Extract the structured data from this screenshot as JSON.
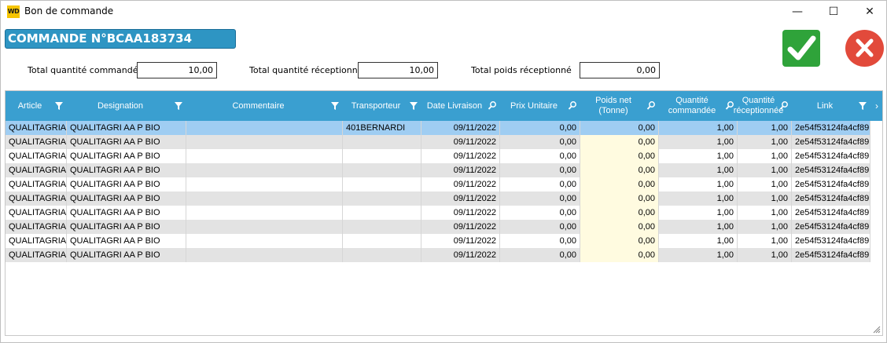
{
  "window": {
    "title": "Bon de commande",
    "app_icon_text": "WD",
    "minimize_glyph": "—",
    "maximize_glyph": "☐",
    "close_glyph": "✕"
  },
  "header": {
    "order_title": "COMMANDE N°BCAA183734",
    "validate_icon": "check-icon",
    "cancel_icon": "close-icon",
    "validate_color": "#2fa33a",
    "cancel_color": "#e24a3b"
  },
  "totals": [
    {
      "label": "Total quantité commandé",
      "value": "10,00"
    },
    {
      "label": "Total quantité réceptionné",
      "value": "10,00"
    },
    {
      "label": "Total poids réceptionné",
      "value": "0,00"
    }
  ],
  "grid": {
    "header_color": "#3a9fd0",
    "columns": [
      {
        "label": "Article",
        "icon": "filter-icon"
      },
      {
        "label": "Designation",
        "icon": "filter-icon"
      },
      {
        "label": "Commentaire",
        "icon": "filter-icon"
      },
      {
        "label": "Transporteur",
        "icon": "filter-icon"
      },
      {
        "label": "Date Livraison",
        "icon": "search-icon"
      },
      {
        "label": "Prix Unitaire",
        "icon": "search-icon"
      },
      {
        "label": "Poids net (Tonne)",
        "icon": "search-icon"
      },
      {
        "label": "Quantité commandée",
        "icon": "search-icon"
      },
      {
        "label": "Quantité réceptionnée",
        "icon": "search-icon"
      },
      {
        "label": "Link",
        "icon": "filter-icon"
      }
    ],
    "rows": [
      [
        "QUALITAGRIA",
        "QUALITAGRI AA P BIO",
        "",
        "401BERNARDI",
        "09/11/2022",
        "0,00",
        "0,00",
        "1,00",
        "1,00",
        "2e54f53124fa4cf89"
      ],
      [
        "QUALITAGRIA",
        "QUALITAGRI AA P BIO",
        "",
        "",
        "09/11/2022",
        "0,00",
        "0,00",
        "1,00",
        "1,00",
        "2e54f53124fa4cf89"
      ],
      [
        "QUALITAGRIA",
        "QUALITAGRI AA P BIO",
        "",
        "",
        "09/11/2022",
        "0,00",
        "0,00",
        "1,00",
        "1,00",
        "2e54f53124fa4cf89"
      ],
      [
        "QUALITAGRIA",
        "QUALITAGRI AA P BIO",
        "",
        "",
        "09/11/2022",
        "0,00",
        "0,00",
        "1,00",
        "1,00",
        "2e54f53124fa4cf89"
      ],
      [
        "QUALITAGRIA",
        "QUALITAGRI AA P BIO",
        "",
        "",
        "09/11/2022",
        "0,00",
        "0,00",
        "1,00",
        "1,00",
        "2e54f53124fa4cf89"
      ],
      [
        "QUALITAGRIA",
        "QUALITAGRI AA P BIO",
        "",
        "",
        "09/11/2022",
        "0,00",
        "0,00",
        "1,00",
        "1,00",
        "2e54f53124fa4cf89"
      ],
      [
        "QUALITAGRIA",
        "QUALITAGRI AA P BIO",
        "",
        "",
        "09/11/2022",
        "0,00",
        "0,00",
        "1,00",
        "1,00",
        "2e54f53124fa4cf89"
      ],
      [
        "QUALITAGRIA",
        "QUALITAGRI AA P BIO",
        "",
        "",
        "09/11/2022",
        "0,00",
        "0,00",
        "1,00",
        "1,00",
        "2e54f53124fa4cf89"
      ],
      [
        "QUALITAGRIA",
        "QUALITAGRI AA P BIO",
        "",
        "",
        "09/11/2022",
        "0,00",
        "0,00",
        "1,00",
        "1,00",
        "2e54f53124fa4cf89"
      ],
      [
        "QUALITAGRIA",
        "QUALITAGRI AA P BIO",
        "",
        "",
        "09/11/2022",
        "0,00",
        "0,00",
        "1,00",
        "1,00",
        "2e54f53124fa4cf89"
      ]
    ]
  }
}
